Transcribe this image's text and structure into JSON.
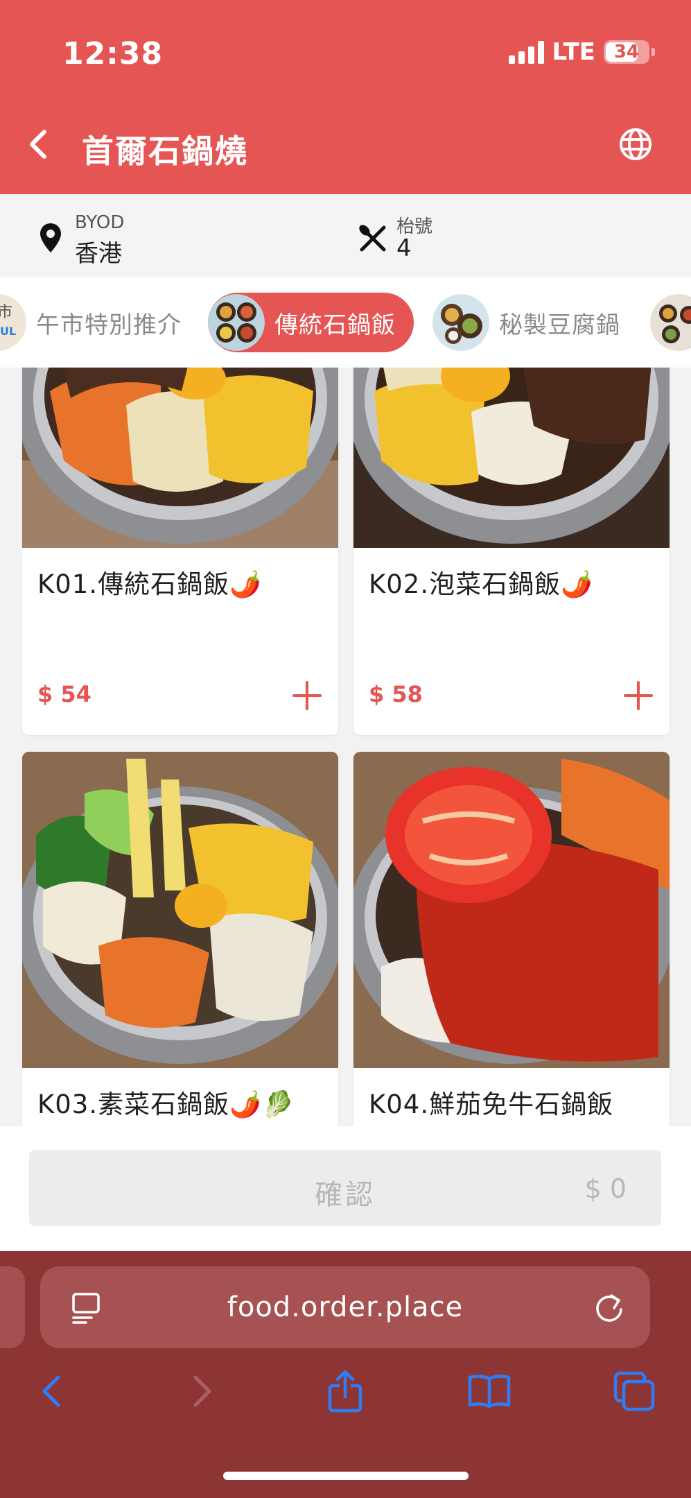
{
  "status_bar": {
    "time": "12:38",
    "network": "LTE",
    "battery": "34"
  },
  "header": {
    "title": "首爾石鍋燒"
  },
  "info_bar": {
    "location": {
      "label": "BYOD",
      "value": "香港"
    },
    "table": {
      "label": "枱號",
      "value": "4"
    }
  },
  "tabs": [
    {
      "label": "午市特別推介",
      "partial_thumb_text": "市 UL"
    },
    {
      "label": "傳統石鍋飯",
      "active": true
    },
    {
      "label": "秘製豆腐鍋"
    }
  ],
  "menu_items": [
    {
      "name": "K01.傳統石鍋飯",
      "emoji": "🌶️",
      "price": "$ 54"
    },
    {
      "name": "K02.泡菜石鍋飯",
      "emoji": "🌶️",
      "price": "$ 58"
    },
    {
      "name": "K03.素菜石鍋飯",
      "emoji": "🌶️🥬"
    },
    {
      "name": "K04.鮮茄免牛石鍋飯",
      "emoji": ""
    }
  ],
  "confirm": {
    "label": "確認",
    "total": "$ 0"
  },
  "browser": {
    "url": "food.order.place"
  },
  "colors": {
    "brand": "#e45553",
    "safari": "#8d3535",
    "ios_blue": "#2f7cf6"
  }
}
